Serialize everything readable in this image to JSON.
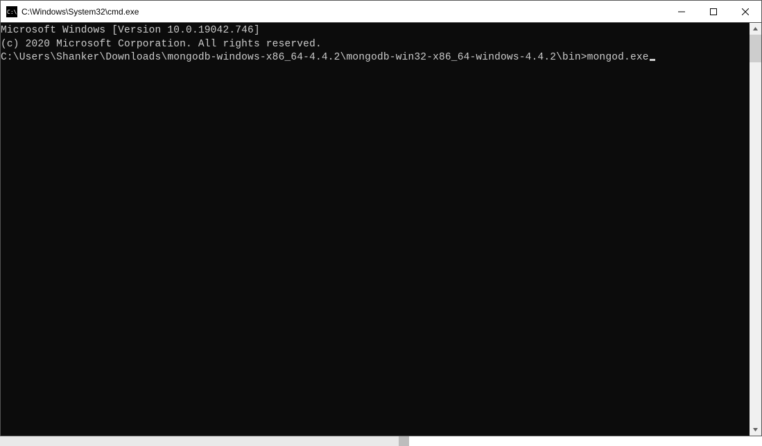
{
  "titlebar": {
    "icon_name": "cmd-icon",
    "title": "C:\\Windows\\System32\\cmd.exe"
  },
  "window_controls": {
    "minimize": "minimize",
    "maximize": "maximize",
    "close": "close"
  },
  "terminal": {
    "lines": [
      "Microsoft Windows [Version 10.0.19042.746]",
      "(c) 2020 Microsoft Corporation. All rights reserved.",
      "",
      "C:\\Users\\Shanker\\Downloads\\mongodb-windows-x86_64-4.4.2\\mongodb-win32-x86_64-windows-4.4.2\\bin>mongod.exe"
    ],
    "cursor_line_index": 3
  },
  "scrollbar": {
    "up": "scroll-up",
    "down": "scroll-down",
    "thumb": "scroll-thumb"
  }
}
